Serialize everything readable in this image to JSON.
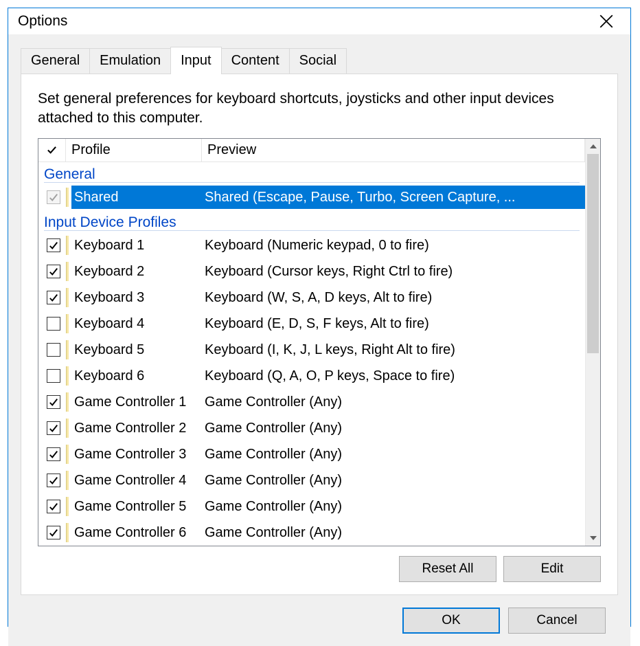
{
  "window": {
    "title": "Options"
  },
  "tabs": [
    {
      "label": "General",
      "active": false
    },
    {
      "label": "Emulation",
      "active": false
    },
    {
      "label": "Input",
      "active": true
    },
    {
      "label": "Content",
      "active": false
    },
    {
      "label": "Social",
      "active": false
    }
  ],
  "description": "Set general preferences for keyboard shortcuts, joysticks and other input devices attached to this computer.",
  "columns": {
    "profile": "Profile",
    "preview": "Preview"
  },
  "groups": [
    {
      "title": "General",
      "rows": [
        {
          "checked": true,
          "disabled": true,
          "selected": true,
          "profile": "Shared",
          "preview": "Shared (Escape, Pause, Turbo, Screen Capture, ..."
        }
      ]
    },
    {
      "title": "Input Device Profiles",
      "rows": [
        {
          "checked": true,
          "disabled": false,
          "selected": false,
          "profile": "Keyboard 1",
          "preview": "Keyboard (Numeric keypad, 0 to fire)"
        },
        {
          "checked": true,
          "disabled": false,
          "selected": false,
          "profile": "Keyboard 2",
          "preview": "Keyboard (Cursor keys, Right Ctrl to fire)"
        },
        {
          "checked": true,
          "disabled": false,
          "selected": false,
          "profile": "Keyboard 3",
          "preview": "Keyboard (W, S, A, D keys, Alt to fire)"
        },
        {
          "checked": false,
          "disabled": false,
          "selected": false,
          "profile": "Keyboard 4",
          "preview": "Keyboard (E, D, S, F keys, Alt to fire)"
        },
        {
          "checked": false,
          "disabled": false,
          "selected": false,
          "profile": "Keyboard 5",
          "preview": "Keyboard (I, K, J, L keys, Right Alt to fire)"
        },
        {
          "checked": false,
          "disabled": false,
          "selected": false,
          "profile": "Keyboard 6",
          "preview": "Keyboard (Q, A, O, P keys, Space to fire)"
        },
        {
          "checked": true,
          "disabled": false,
          "selected": false,
          "profile": "Game Controller 1",
          "preview": "Game Controller (Any)"
        },
        {
          "checked": true,
          "disabled": false,
          "selected": false,
          "profile": "Game Controller 2",
          "preview": "Game Controller (Any)"
        },
        {
          "checked": true,
          "disabled": false,
          "selected": false,
          "profile": "Game Controller 3",
          "preview": "Game Controller (Any)"
        },
        {
          "checked": true,
          "disabled": false,
          "selected": false,
          "profile": "Game Controller 4",
          "preview": "Game Controller (Any)"
        },
        {
          "checked": true,
          "disabled": false,
          "selected": false,
          "profile": "Game Controller 5",
          "preview": "Game Controller (Any)"
        },
        {
          "checked": true,
          "disabled": false,
          "selected": false,
          "profile": "Game Controller 6",
          "preview": "Game Controller (Any)"
        }
      ]
    }
  ],
  "panel_buttons": {
    "reset": "Reset All",
    "edit": "Edit"
  },
  "dialog_buttons": {
    "ok": "OK",
    "cancel": "Cancel"
  }
}
